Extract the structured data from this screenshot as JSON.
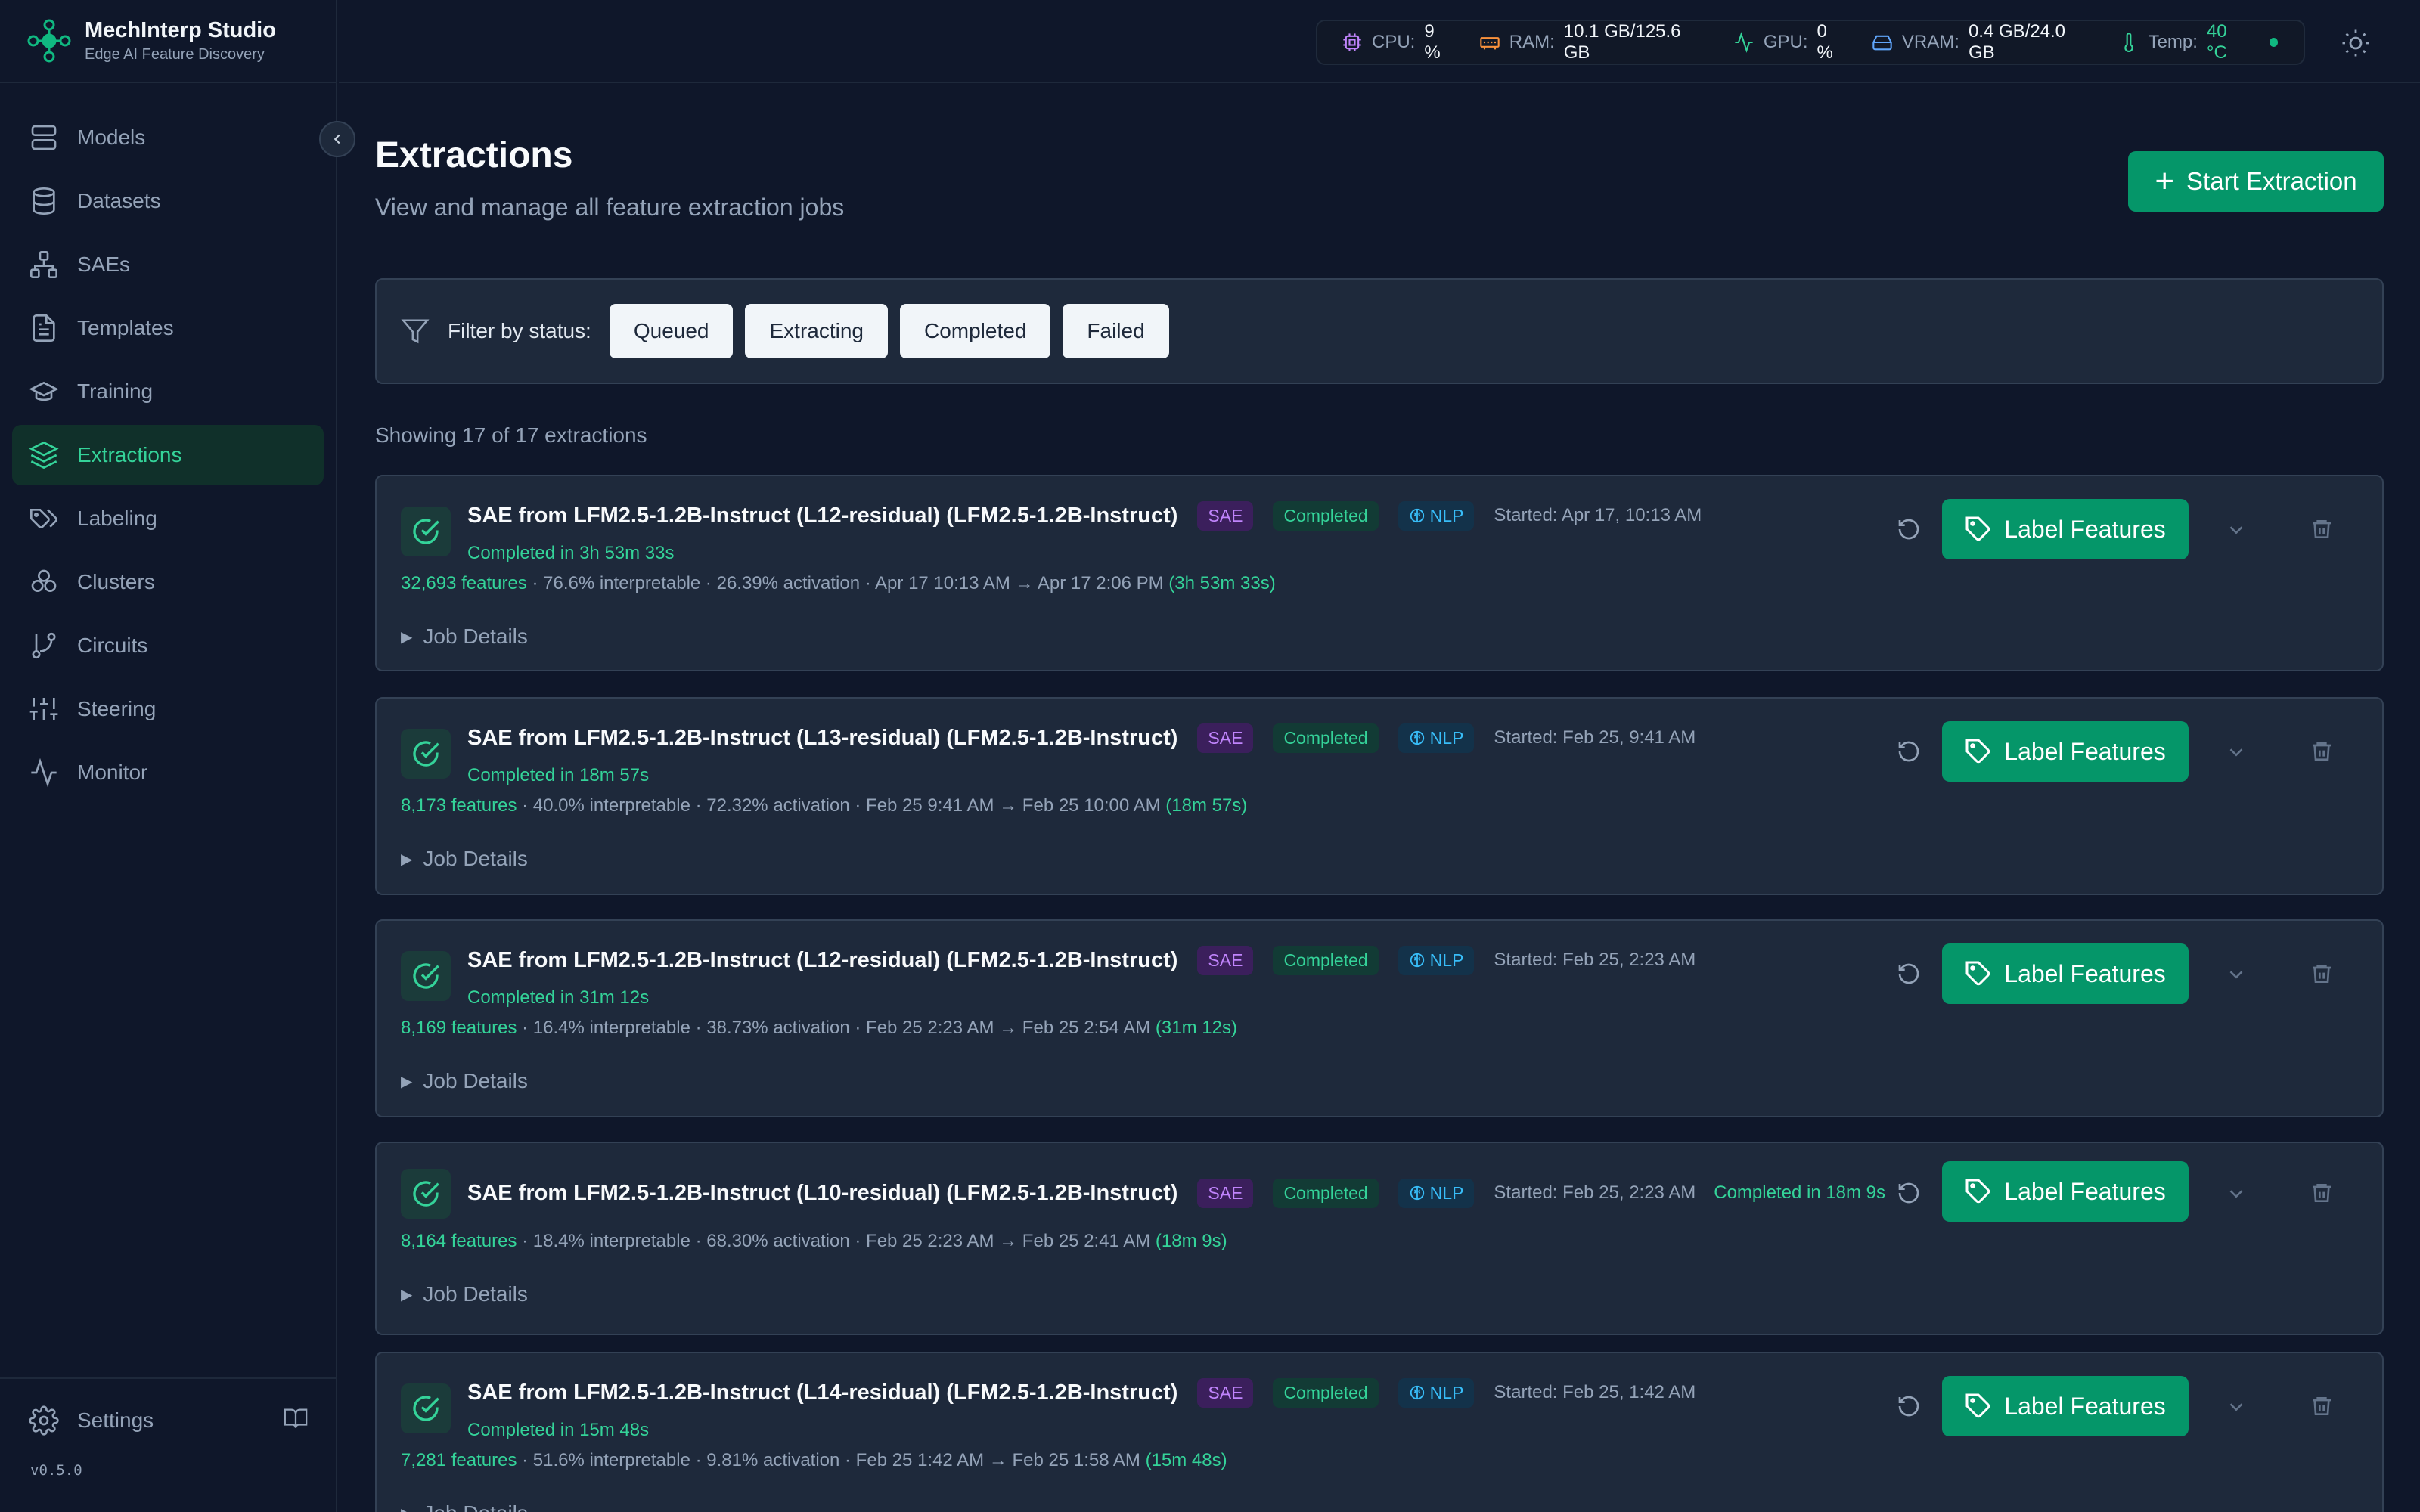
{
  "app": {
    "name": "MechInterp Studio",
    "subtitle": "Edge AI Feature Discovery",
    "version": "v0.5.0"
  },
  "nav": [
    {
      "label": "Models",
      "icon": "server-icon"
    },
    {
      "label": "Datasets",
      "icon": "database-icon"
    },
    {
      "label": "SAEs",
      "icon": "network-icon"
    },
    {
      "label": "Templates",
      "icon": "file-text-icon"
    },
    {
      "label": "Training",
      "icon": "graduation-cap-icon"
    },
    {
      "label": "Extractions",
      "icon": "layers-icon",
      "active": true
    },
    {
      "label": "Labeling",
      "icon": "tags-icon"
    },
    {
      "label": "Clusters",
      "icon": "clusters-icon"
    },
    {
      "label": "Circuits",
      "icon": "git-branch-icon"
    },
    {
      "label": "Steering",
      "icon": "sliders-icon"
    },
    {
      "label": "Monitor",
      "icon": "activity-icon"
    }
  ],
  "settings_label": "Settings",
  "system": {
    "cpu_label": "CPU:",
    "cpu": "9 %",
    "ram_label": "RAM:",
    "ram": "10.1 GB/125.6 GB",
    "gpu_label": "GPU:",
    "gpu": "0 %",
    "vram_label": "VRAM:",
    "vram": "0.4 GB/24.0 GB",
    "temp_label": "Temp:",
    "temp": "40 °C"
  },
  "page": {
    "title": "Extractions",
    "subtitle": "View and manage all feature extraction jobs",
    "start_button": "Start Extraction",
    "filter_label": "Filter by status:",
    "filters": [
      "Queued",
      "Extracting",
      "Completed",
      "Failed"
    ],
    "showing": "Showing 17 of 17 extractions"
  },
  "colors": {
    "accent": "#059669",
    "accent_text": "#34d399",
    "bg": "#0f172a",
    "card": "#1e293b"
  },
  "extractions": [
    {
      "title": "SAE from LFM2.5-1.2B-Instruct (L12-residual) (LFM2.5-1.2B-Instruct)",
      "type": "SAE",
      "status": "Completed",
      "domain": "NLP",
      "started": "Started: Apr 17, 10:13 AM",
      "duration": "Completed in 3h 53m 33s",
      "features": "32,693 features",
      "summary": " · 76.6% interpretable · 26.39% activation · Apr 17 10:13 AM → Apr 17 2:06 PM ",
      "elapsed": "(3h 53m 33s)",
      "details": "Job Details",
      "label_button": "Label Features"
    },
    {
      "title": "SAE from LFM2.5-1.2B-Instruct (L13-residual) (LFM2.5-1.2B-Instruct)",
      "type": "SAE",
      "status": "Completed",
      "domain": "NLP",
      "started": "Started: Feb 25, 9:41 AM",
      "duration": "Completed in 18m 57s",
      "features": "8,173 features",
      "summary": " · 40.0% interpretable · 72.32% activation · Feb 25 9:41 AM → Feb 25 10:00 AM ",
      "elapsed": "(18m 57s)",
      "details": "Job Details",
      "label_button": "Label Features"
    },
    {
      "title": "SAE from LFM2.5-1.2B-Instruct (L12-residual) (LFM2.5-1.2B-Instruct)",
      "type": "SAE",
      "status": "Completed",
      "domain": "NLP",
      "started": "Started: Feb 25, 2:23 AM",
      "duration": "Completed in 31m 12s",
      "features": "8,169 features",
      "summary": " · 16.4% interpretable · 38.73% activation · Feb 25 2:23 AM → Feb 25 2:54 AM ",
      "elapsed": "(31m 12s)",
      "details": "Job Details",
      "label_button": "Label Features"
    },
    {
      "title": "SAE from LFM2.5-1.2B-Instruct (L10-residual) (LFM2.5-1.2B-Instruct)",
      "type": "SAE",
      "status": "Completed",
      "domain": "NLP",
      "started": "Started: Feb 25, 2:23 AM",
      "duration": "Completed in 18m 9s",
      "features": "8,164 features",
      "summary": " · 18.4% interpretable · 68.30% activation · Feb 25 2:23 AM → Feb 25 2:41 AM ",
      "elapsed": "(18m 9s)",
      "details": "Job Details",
      "label_button": "Label Features"
    },
    {
      "title": "SAE from LFM2.5-1.2B-Instruct (L14-residual) (LFM2.5-1.2B-Instruct)",
      "type": "SAE",
      "status": "Completed",
      "domain": "NLP",
      "started": "Started: Feb 25, 1:42 AM",
      "duration": "Completed in 15m 48s",
      "features": "7,281 features",
      "summary": " · 51.6% interpretable · 9.81% activation · Feb 25 1:42 AM → Feb 25 1:58 AM ",
      "elapsed": "(15m 48s)",
      "details": "Job Details",
      "label_button": "Label Features"
    }
  ]
}
